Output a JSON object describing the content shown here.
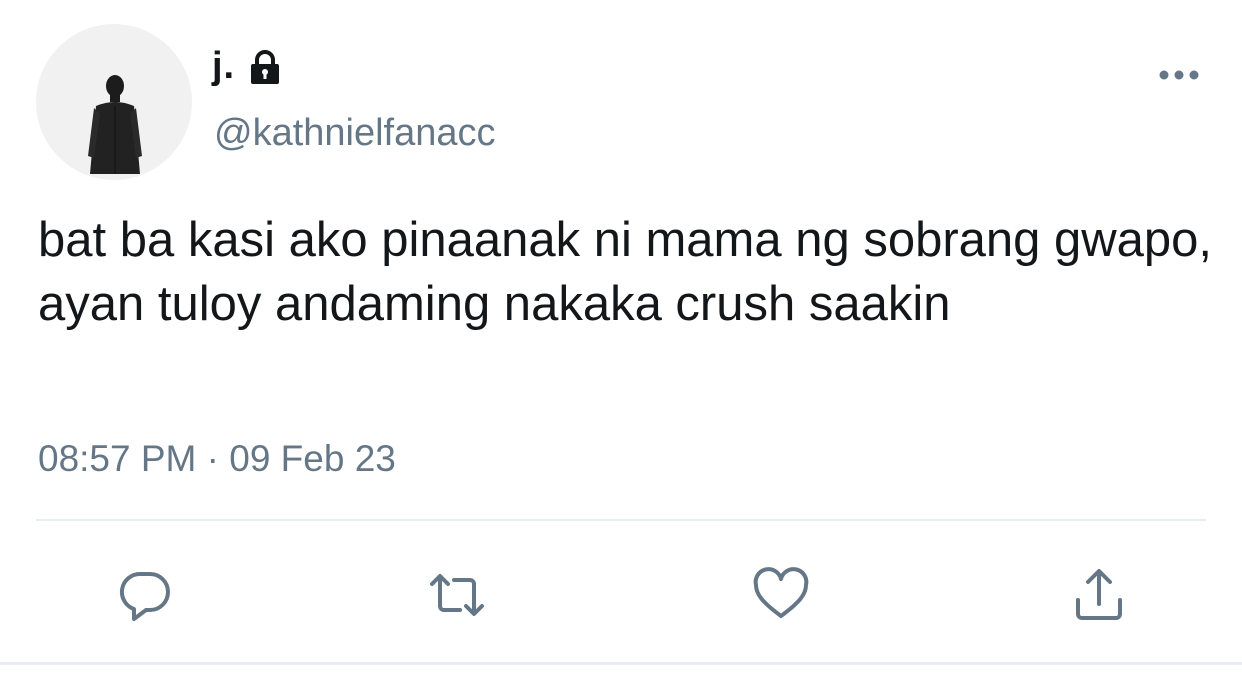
{
  "user": {
    "display_name": "j.",
    "handle": "@kathnielfanacc",
    "protected_icon": "lock-icon",
    "avatar_icon": "person-in-suit-avatar"
  },
  "tweet": {
    "text": "bat ba kasi ako pinaanak ni mama ng sobrang gwapo, ayan tuloy andaming nakaka crush saakin",
    "timestamp": "08:57 PM · 09 Feb 23"
  },
  "actions": {
    "reply_icon": "reply-icon",
    "retweet_icon": "retweet-icon",
    "like_icon": "heart-icon",
    "share_icon": "share-icon",
    "more_icon": "more-icon"
  },
  "colors": {
    "text_primary": "#14171a",
    "text_secondary": "#657786",
    "divider": "#e6ecf0"
  }
}
